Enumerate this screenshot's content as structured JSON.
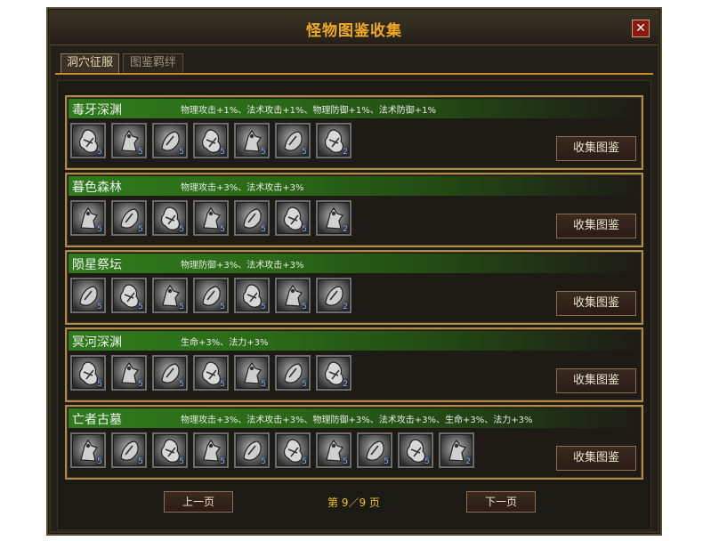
{
  "window": {
    "title": "怪物图鉴收集",
    "close_label": "✕"
  },
  "tabs": [
    {
      "label": "洞穴征服"
    },
    {
      "label": "图鉴羁绊"
    }
  ],
  "collect_label": "收集图鉴",
  "panels": [
    {
      "name": "毒牙深渊",
      "bonus": "物理攻击+1%、法术攻击+1%、物理防御+1%、法术防御+1%",
      "counts": [
        "5",
        "5",
        "5",
        "5",
        "5",
        "5",
        "2"
      ]
    },
    {
      "name": "暮色森林",
      "bonus": "物理攻击+3%、法术攻击+3%",
      "counts": [
        "5",
        "5",
        "5",
        "5",
        "5",
        "5",
        "2"
      ]
    },
    {
      "name": "陨星祭坛",
      "bonus": "物理防御+3%、法术攻击+3%",
      "counts": [
        "5",
        "5",
        "5",
        "5",
        "5",
        "5",
        "2"
      ]
    },
    {
      "name": "冥河深渊",
      "bonus": "生命+3%、法力+3%",
      "counts": [
        "5",
        "5",
        "5",
        "5",
        "5",
        "5",
        "2"
      ]
    },
    {
      "name": "亡者古墓",
      "bonus": "物理攻击+3%、法术攻击+3%、物理防御+3%、法术攻击+3%、生命+3%、法力+3%",
      "counts": [
        "5",
        "5",
        "5",
        "5",
        "5",
        "5",
        "5",
        "5",
        "5",
        "2"
      ]
    }
  ],
  "pagination": {
    "prev_label": "上一页",
    "next_label": "下一页",
    "page_info": "第 9／9 页"
  }
}
